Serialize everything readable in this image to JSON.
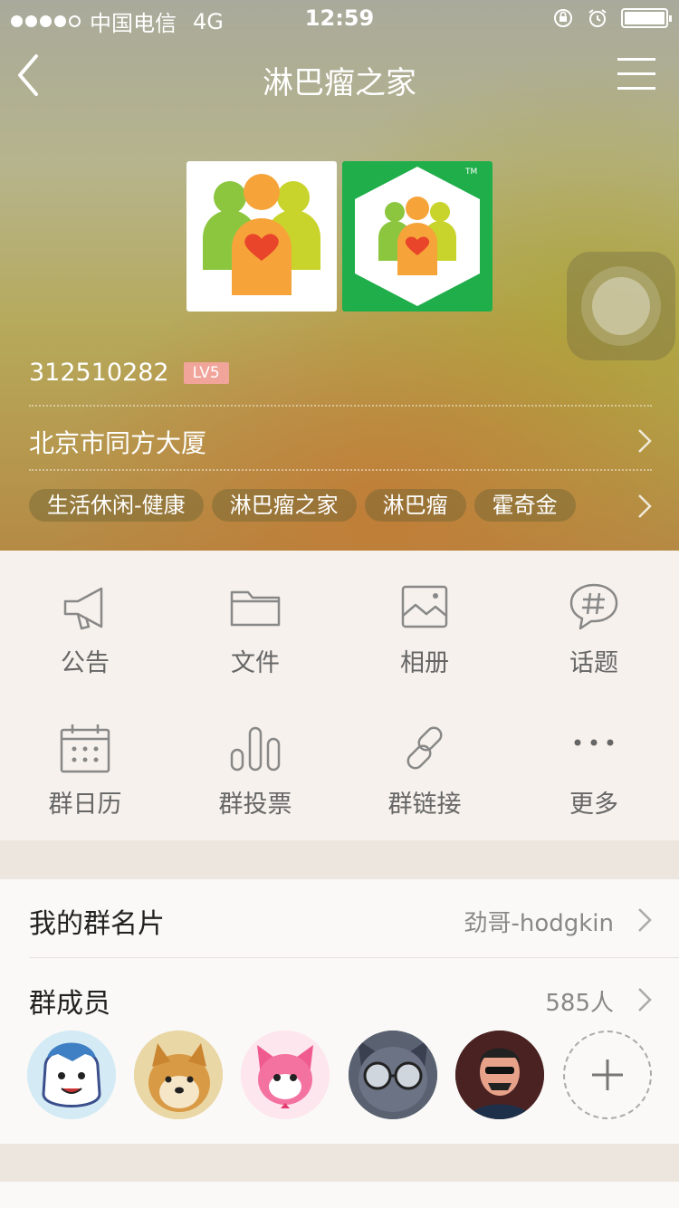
{
  "status_bar": {
    "carrier": "中国电信",
    "network": "4G",
    "time": "12:59"
  },
  "nav": {
    "title": "淋巴瘤之家"
  },
  "group": {
    "id": "312510282",
    "level": "LV5",
    "location": "北京市同方大厦",
    "tags": [
      "生活休闲-健康",
      "淋巴瘤之家",
      "淋巴瘤",
      "霍奇金"
    ]
  },
  "features": [
    {
      "label": "公告",
      "icon": "megaphone-icon"
    },
    {
      "label": "文件",
      "icon": "folder-icon"
    },
    {
      "label": "相册",
      "icon": "image-icon"
    },
    {
      "label": "话题",
      "icon": "hashtag-icon"
    },
    {
      "label": "群日历",
      "icon": "calendar-icon"
    },
    {
      "label": "群投票",
      "icon": "bar-chart-icon"
    },
    {
      "label": "群链接",
      "icon": "link-icon"
    },
    {
      "label": "更多",
      "icon": "more-icon"
    }
  ],
  "card": {
    "label": "我的群名片",
    "value": "劲哥-hodgkin"
  },
  "members": {
    "label": "群成员",
    "count": "585人"
  },
  "colors": {
    "accent_badge": "#f0a49a",
    "logo_green": "#1fae4a"
  }
}
